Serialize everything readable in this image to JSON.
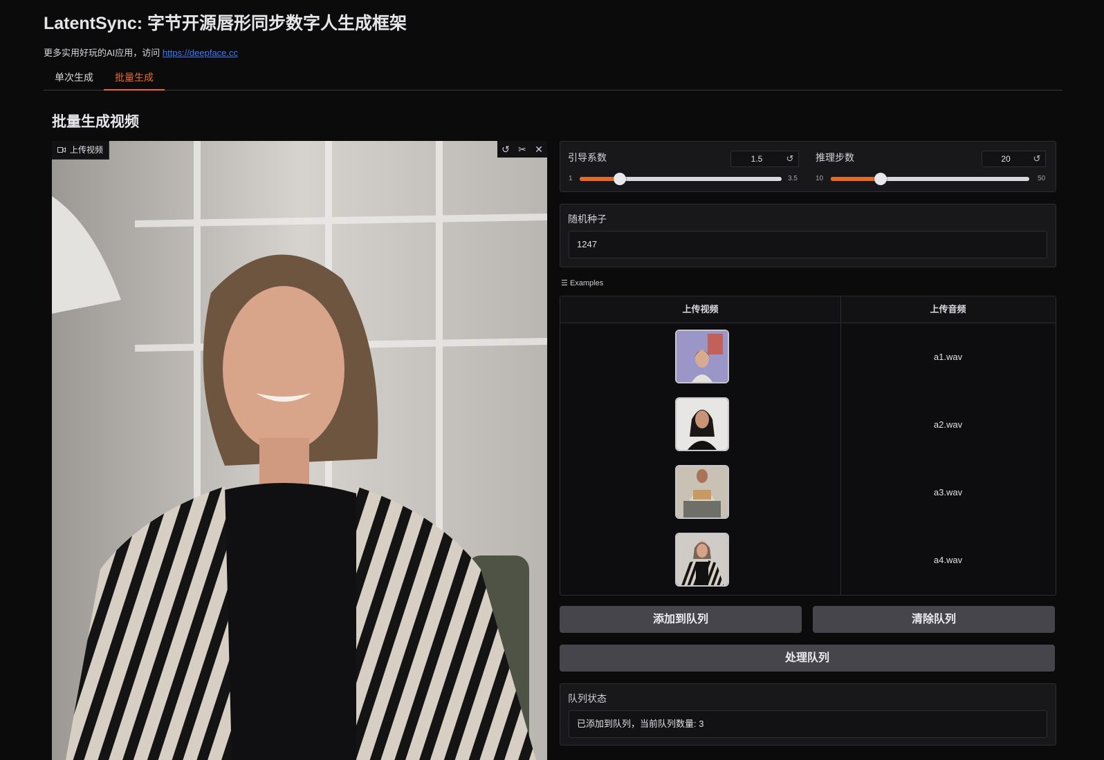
{
  "header": {
    "title": "LatentSync: 字节开源唇形同步数字人生成框架",
    "subtitle_prefix": "更多实用好玩的AI应用，访问 ",
    "subtitle_link": "https://deepface.cc"
  },
  "tabs": [
    {
      "label": "单次生成",
      "active": false
    },
    {
      "label": "批量生成",
      "active": true
    }
  ],
  "section_title": "批量生成视频",
  "video_input": {
    "label": "上传视频",
    "icons": [
      "undo-icon",
      "scissors-icon",
      "close-icon"
    ]
  },
  "guidance": {
    "label": "引导系数",
    "value": "1.5",
    "min": "1",
    "max": "3.5",
    "fraction": 0.2
  },
  "steps": {
    "label": "推理步数",
    "value": "20",
    "min": "10",
    "max": "50",
    "fraction": 0.25
  },
  "seed": {
    "label": "随机种子",
    "value": "1247"
  },
  "examples": {
    "title": "Examples",
    "headers": [
      "上传视频",
      "上传音频"
    ],
    "rows": [
      {
        "audio": "a1.wav"
      },
      {
        "audio": "a2.wav"
      },
      {
        "audio": "a3.wav"
      },
      {
        "audio": "a4.wav"
      }
    ]
  },
  "buttons": {
    "add_queue": "添加到队列",
    "clear_queue": "清除队列",
    "process_queue": "处理队列"
  },
  "queue_status": {
    "label": "队列状态",
    "value": "已添加到队列，当前队列数量: 3"
  },
  "colors": {
    "accent": "#ea6a32",
    "background": "#0b0b0c"
  }
}
